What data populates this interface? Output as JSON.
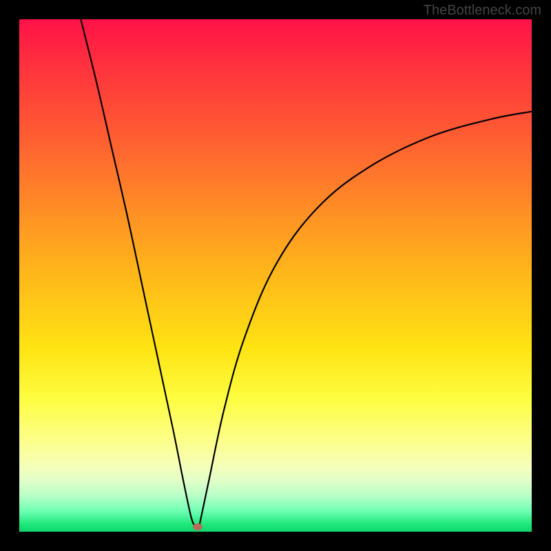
{
  "watermark": "TheBottleneck.com",
  "chart_data": {
    "type": "line",
    "title": "",
    "xlabel": "",
    "ylabel": "",
    "xlim": [
      0,
      100
    ],
    "ylim": [
      0,
      100
    ],
    "grid": false,
    "legend": false,
    "curve_left": [
      {
        "x": 12,
        "y": 100
      },
      {
        "x": 15,
        "y": 88
      },
      {
        "x": 18,
        "y": 75
      },
      {
        "x": 21,
        "y": 62
      },
      {
        "x": 24,
        "y": 48
      },
      {
        "x": 27,
        "y": 34
      },
      {
        "x": 30,
        "y": 20
      },
      {
        "x": 32,
        "y": 10
      },
      {
        "x": 33.5,
        "y": 3
      },
      {
        "x": 34.2,
        "y": 1.2
      }
    ],
    "curve_right": [
      {
        "x": 35.2,
        "y": 1.5
      },
      {
        "x": 37,
        "y": 10
      },
      {
        "x": 40,
        "y": 24
      },
      {
        "x": 44,
        "y": 38
      },
      {
        "x": 50,
        "y": 52
      },
      {
        "x": 58,
        "y": 63
      },
      {
        "x": 68,
        "y": 71
      },
      {
        "x": 80,
        "y": 77
      },
      {
        "x": 92,
        "y": 80.5
      },
      {
        "x": 100,
        "y": 82
      }
    ],
    "minimum_marker": {
      "x": 34.8,
      "y": 1.0
    }
  }
}
